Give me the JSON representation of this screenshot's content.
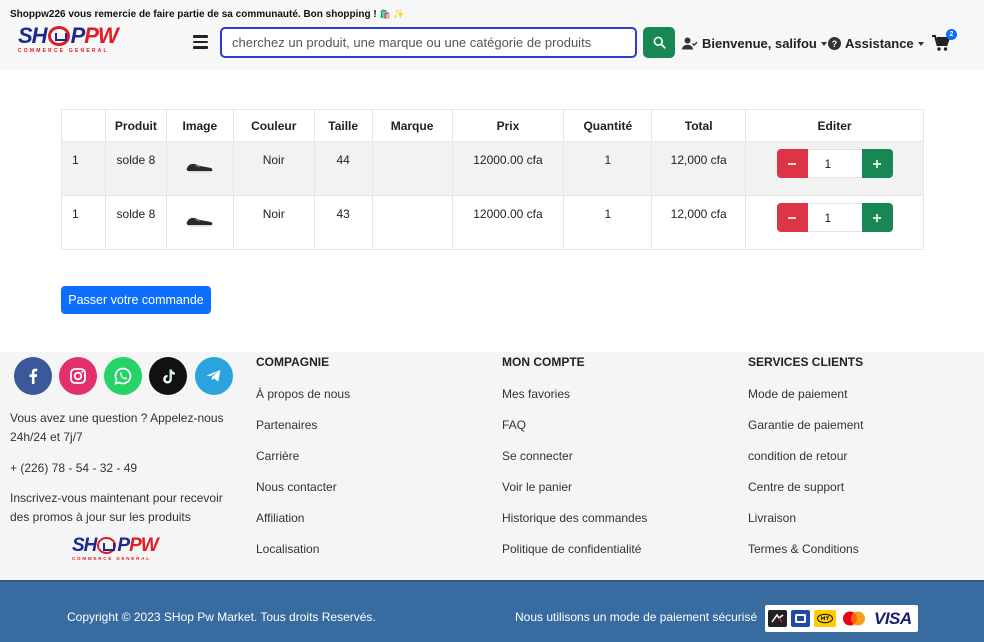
{
  "header": {
    "welcome": "Shoppw226 vous remercie de faire partie de sa communauté. Bon shopping !",
    "emoji": "🛍️ ✨",
    "logo_main": "SH",
    "logo_end": "P",
    "logo_pw": "PW",
    "logo_sub": "COMMERCE GENERAL",
    "search_placeholder": "cherchez un produit, une marque ou une catégorie de produits",
    "user_label": "Bienvenue, salifou",
    "help_label": "Assistance",
    "cart_count": "2"
  },
  "table": {
    "headers": [
      "",
      "Produit",
      "Image",
      "Couleur",
      "Taille",
      "Marque",
      "Prix",
      "Quantité",
      "Total",
      "Editer"
    ],
    "rows": [
      {
        "idx": "1",
        "product": "solde 8",
        "color": "Noir",
        "size": "44",
        "brand": "",
        "price": "12000.00 cfa",
        "qty": "1",
        "total": "12,000 cfa",
        "edit_qty": "1"
      },
      {
        "idx": "1",
        "product": "solde 8",
        "color": "Noir",
        "size": "43",
        "brand": "",
        "price": "12000.00 cfa",
        "qty": "1",
        "total": "12,000 cfa",
        "edit_qty": "1"
      }
    ]
  },
  "order_button": "Passer votre commande",
  "footer": {
    "question": "Vous avez une question ? Appelez-nous 24h/24 et 7j/7",
    "phone": "+ (226) 78 - 54 - 32 - 49",
    "newsletter": "Inscrivez-vous maintenant pour recevoir des promos à jour sur les produits",
    "columns": [
      {
        "title": "COMPAGNIE",
        "links": [
          "À propos de nous",
          "Partenaires",
          "Carrière",
          "Nous contacter",
          "Affiliation",
          "Localisation"
        ]
      },
      {
        "title": "MON COMPTE",
        "links": [
          "Mes favories",
          "FAQ",
          "Se connecter",
          "Voir le panier",
          "Historique des commandes",
          "Politique de confidentialité"
        ]
      },
      {
        "title": "SERVICES CLIENTS",
        "links": [
          "Mode de paiement",
          "Garantie de paiement",
          "condition de retour",
          "Centre de support",
          "Livraison",
          "Termes & Conditions"
        ]
      }
    ],
    "social": [
      "facebook-icon",
      "instagram-icon",
      "whatsapp-icon",
      "tiktok-icon",
      "telegram-icon"
    ]
  },
  "bottom": {
    "copyright": "Copyright © 2023 SHop Pw Market. Tous droits Reservés.",
    "secure": "Nous utilisons un mode de paiement sécurisé",
    "visa": "VISA"
  },
  "colors": {
    "brand_blue": "#1b2a8c",
    "brand_red": "#e01c24",
    "primary": "#0d6efd",
    "success": "#198754",
    "danger": "#dc3545",
    "footer_bar": "#386b9f"
  }
}
